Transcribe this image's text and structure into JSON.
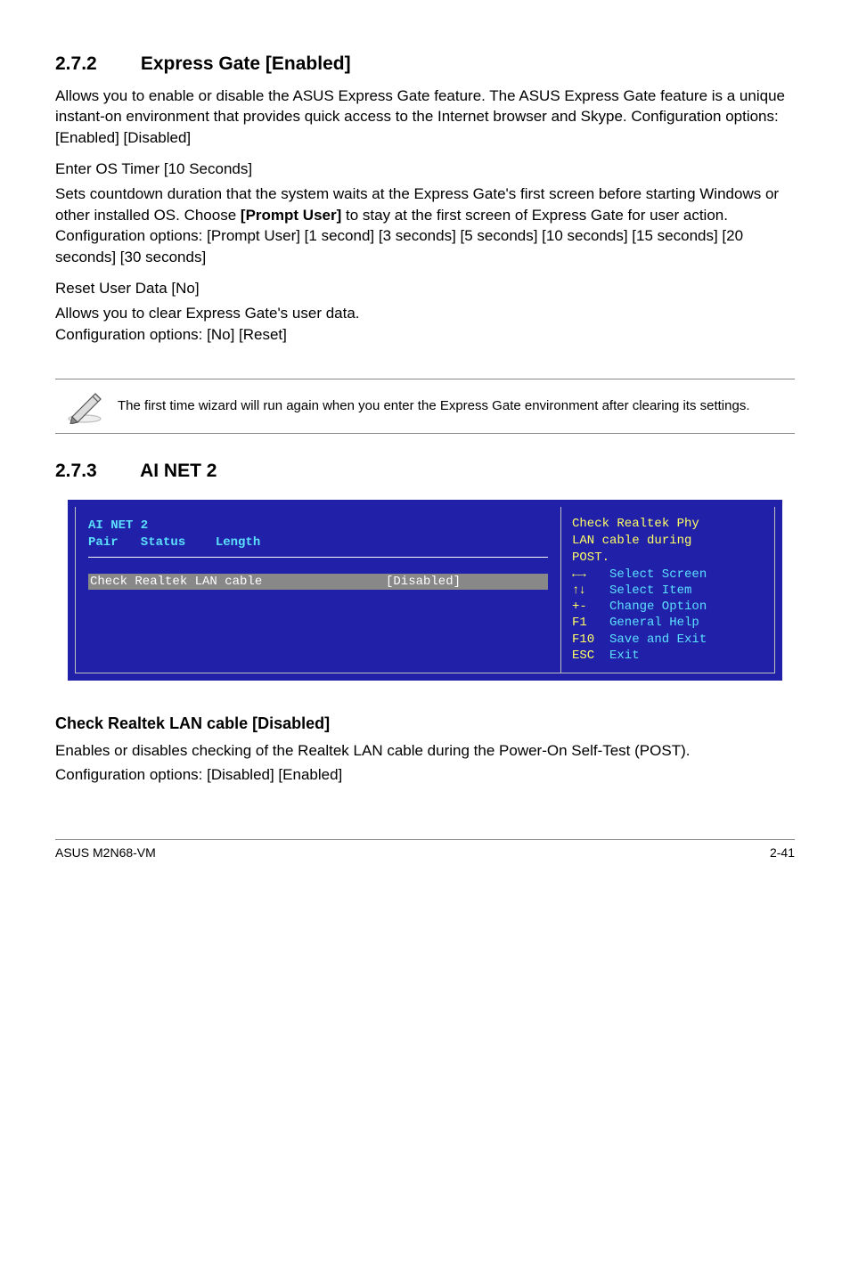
{
  "sec272": {
    "number": "2.7.2",
    "title": "Express Gate [Enabled]",
    "p1": "Allows you to enable or disable the ASUS Express Gate feature. The ASUS Express Gate feature is a unique instant-on environment that provides quick access to the Internet browser and Skype. Configuration options: [Enabled] [Disabled]",
    "os_timer_head": "Enter OS Timer [10 Seconds]",
    "os_timer_body_1": "Sets countdown duration that the system waits at the Express Gate's first screen before starting Windows or other installed OS. Choose ",
    "os_timer_body_strong": "[Prompt User]",
    "os_timer_body_2": " to stay at the first screen of Express Gate for user action.",
    "os_timer_body_3": "Configuration options: [Prompt User] [1 second] [3 seconds] [5 seconds] [10 seconds] [15 seconds] [20 seconds] [30 seconds]",
    "reset_head": "Reset User Data [No]",
    "reset_body_1": "Allows you to clear Express Gate's user data.",
    "reset_body_2": "Configuration options: [No] [Reset]",
    "note": "The first time wizard will run again when you enter the Express Gate environment after clearing its settings."
  },
  "sec273": {
    "number": "2.7.3",
    "title": "AI NET 2"
  },
  "bios": {
    "header_l1": "AI NET 2",
    "header_l2": "Pair   Status    Length",
    "item_label": "Check Realtek LAN cable",
    "item_value": "[Disabled]",
    "help": "Check Realtek Phy\nLAN cable during\nPOST.",
    "keys": [
      {
        "k": "←→",
        "d": "Select Screen",
        "cls": "arrow-lr"
      },
      {
        "k": "↑↓",
        "d": "Select Item",
        "cls": "arrow-ud"
      },
      {
        "k": "+-",
        "d": "Change Option",
        "cls": ""
      },
      {
        "k": "F1",
        "d": "General Help",
        "cls": ""
      },
      {
        "k": "F10",
        "d": "Save and Exit",
        "cls": ""
      },
      {
        "k": "ESC",
        "d": "Exit",
        "cls": ""
      }
    ]
  },
  "check_lan": {
    "title": "Check Realtek LAN cable [Disabled]",
    "body1": "Enables or disables checking of the Realtek LAN cable during the Power-On Self-Test (POST).",
    "body2": "Configuration options: [Disabled] [Enabled]"
  },
  "footer": {
    "left": "ASUS M2N68-VM",
    "right": "2-41"
  }
}
